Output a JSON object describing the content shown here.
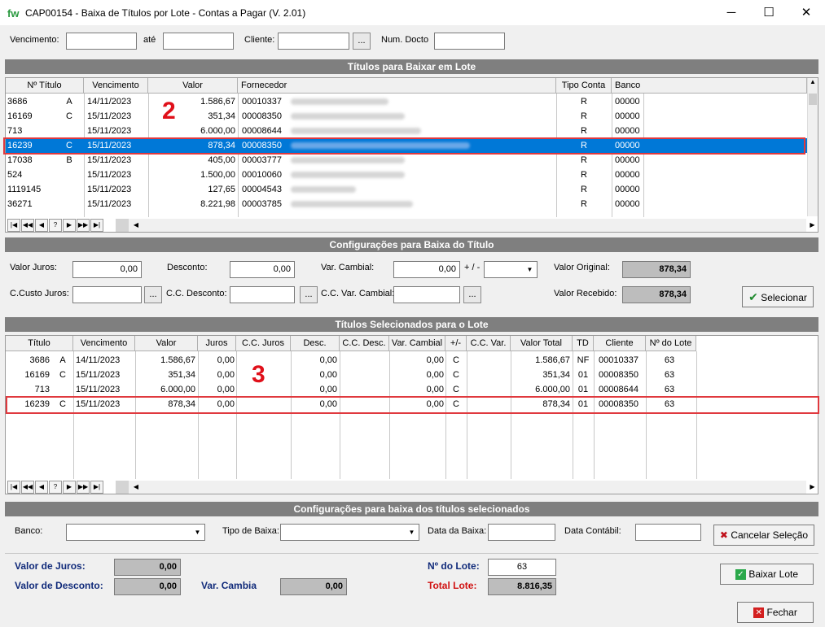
{
  "window": {
    "logo": "fw",
    "title": "CAP00154 - Baixa de Títulos por Lote - Contas a Pagar   (V. 2.01)",
    "min": "─",
    "max": "☐",
    "close": "✕"
  },
  "filters": {
    "vencimento_label": "Vencimento:",
    "ate_label": "até",
    "cliente_label": "Cliente:",
    "cliente_btn": "...",
    "num_docto_label": "Num. Docto",
    "vencimento_de": "",
    "vencimento_ate": "",
    "cliente": "",
    "num_docto": ""
  },
  "titulos": {
    "title": "Títulos para Baixar em Lote",
    "columns": [
      "Nº Título",
      "Vencimento",
      "Valor",
      "Fornecedor",
      "Tipo Conta",
      "Banco"
    ],
    "rows": [
      {
        "num": "3686",
        "parc": "A",
        "venc": "14/11/2023",
        "valor": "1.586,67",
        "forn": "00010337",
        "tipo": "R",
        "banco": "00000"
      },
      {
        "num": "16169",
        "parc": "C",
        "venc": "15/11/2023",
        "valor": "351,34",
        "forn": "00008350",
        "tipo": "R",
        "banco": "00000"
      },
      {
        "num": "713",
        "parc": "",
        "venc": "15/11/2023",
        "valor": "6.000,00",
        "forn": "00008644",
        "tipo": "R",
        "banco": "00000"
      },
      {
        "num": "16239",
        "parc": "C",
        "venc": "15/11/2023",
        "valor": "878,34",
        "forn": "00008350",
        "tipo": "R",
        "banco": "00000"
      },
      {
        "num": "17038",
        "parc": "B",
        "venc": "15/11/2023",
        "valor": "405,00",
        "forn": "00003777",
        "tipo": "R",
        "banco": "00000"
      },
      {
        "num": "524",
        "parc": "",
        "venc": "15/11/2023",
        "valor": "1.500,00",
        "forn": "00010060",
        "tipo": "R",
        "banco": "00000"
      },
      {
        "num": "1119145",
        "parc": "",
        "venc": "15/11/2023",
        "valor": "127,65",
        "forn": "00004543",
        "tipo": "R",
        "banco": "00000"
      },
      {
        "num": "36271",
        "parc": "",
        "venc": "15/11/2023",
        "valor": "8.221,98",
        "forn": "00003785",
        "tipo": "R",
        "banco": "00000"
      }
    ]
  },
  "nav": [
    "|◀",
    "◀◀",
    "◀",
    "?",
    "▶",
    "▶▶",
    "▶|"
  ],
  "config": {
    "title": "Configurações para Baixa do Título",
    "valor_juros_label": "Valor Juros:",
    "valor_juros": "0,00",
    "desconto_label": "Desconto:",
    "desconto": "0,00",
    "var_cambial_label": "Var. Cambial:",
    "var_cambial": "0,00",
    "sinal_label": "+ / -",
    "sinal": "",
    "valor_original_label": "Valor Original:",
    "valor_original": "878,34",
    "cc_juros_label": "C.Custo Juros:",
    "cc_desconto_label": "C.C. Desconto:",
    "cc_var_label": "C.C. Var. Cambial:",
    "valor_recebido_label": "Valor Recebido:",
    "valor_recebido": "878,34",
    "selecionar": "Selecionar",
    "dots": "..."
  },
  "selecionados": {
    "title": "Títulos Selecionados para o Lote",
    "columns": [
      "Título",
      "Vencimento",
      "Valor",
      "Juros",
      "C.C. Juros",
      "Desc.",
      "C.C. Desc.",
      "Var. Cambial",
      "+/-",
      "C.C. Var.",
      "Valor Total",
      "TD",
      "Cliente",
      "Nº do Lote"
    ],
    "rows": [
      {
        "num": "3686",
        "parc": "A",
        "venc": "14/11/2023",
        "valor": "1.586,67",
        "juros": "0,00",
        "desc": "0,00",
        "var": "0,00",
        "sinal": "C",
        "total": "1.586,67",
        "td": "NF",
        "cliente": "00010337",
        "lote": "63"
      },
      {
        "num": "16169",
        "parc": "C",
        "venc": "15/11/2023",
        "valor": "351,34",
        "juros": "0,00",
        "desc": "0,00",
        "var": "0,00",
        "sinal": "C",
        "total": "351,34",
        "td": "01",
        "cliente": "00008350",
        "lote": "63"
      },
      {
        "num": "713",
        "parc": "",
        "venc": "15/11/2023",
        "valor": "6.000,00",
        "juros": "0,00",
        "desc": "0,00",
        "var": "0,00",
        "sinal": "C",
        "total": "6.000,00",
        "td": "01",
        "cliente": "00008644",
        "lote": "63"
      },
      {
        "num": "16239",
        "parc": "C",
        "venc": "15/11/2023",
        "valor": "878,34",
        "juros": "0,00",
        "desc": "0,00",
        "var": "0,00",
        "sinal": "C",
        "total": "878,34",
        "td": "01",
        "cliente": "00008350",
        "lote": "63"
      }
    ]
  },
  "lote_config": {
    "title": "Configurações para baixa dos títulos selecionados",
    "banco_label": "Banco:",
    "tipo_baixa_label": "Tipo de Baixa:",
    "data_baixa_label": "Data da Baixa:",
    "data_contabil_label": "Data Contábil:",
    "cancelar": "Cancelar Seleção"
  },
  "totals": {
    "valor_juros_label": "Valor de Juros:",
    "valor_juros": "0,00",
    "valor_desconto_label": "Valor de Desconto:",
    "valor_desconto": "0,00",
    "var_cambia_label": "Var. Cambia",
    "var_cambia": "0,00",
    "num_lote_label": "Nº do Lote:",
    "num_lote": "63",
    "total_lote_label": "Total Lote:",
    "total_lote": "8.816,35",
    "baixar": "Baixar Lote",
    "fechar": "Fechar"
  },
  "annotations": {
    "a2": "2",
    "a3": "3"
  },
  "colors": {
    "selection": "#0078d7",
    "band": "#7f7f7f",
    "highlight": "#e0393e",
    "total_lote_label": "#d01010"
  }
}
